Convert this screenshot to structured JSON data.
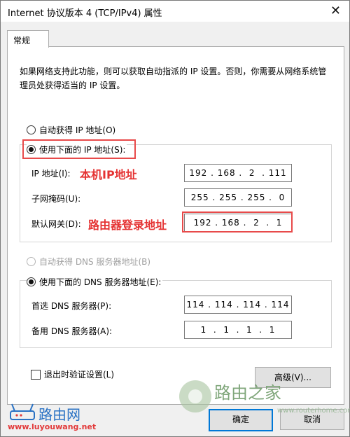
{
  "window": {
    "title": "Internet 协议版本 4 (TCP/IPv4) 属性",
    "close_glyph": "✕"
  },
  "tab": {
    "label": "常规"
  },
  "description": "如果网络支持此功能，则可以获取自动指派的 IP 设置。否则，你需要从网络系统管理员处获得适当的 IP 设置。",
  "ip_section": {
    "auto_label": "自动获得 IP 地址(O)",
    "manual_label": "使用下面的 IP 地址(S):",
    "fields": [
      {
        "label": "IP 地址(I):",
        "value": "192 . 168 .  2  . 111"
      },
      {
        "label": "子网掩码(U):",
        "value": "255 . 255 . 255 .  0"
      },
      {
        "label": "默认网关(D):",
        "value": "192 . 168 .  2  .  1"
      }
    ]
  },
  "dns_section": {
    "auto_label": "自动获得 DNS 服务器地址(B)",
    "manual_label": "使用下面的 DNS 服务器地址(E):",
    "fields": [
      {
        "label": "首选 DNS 服务器(P):",
        "value": "114 . 114 . 114 . 114"
      },
      {
        "label": "备用 DNS 服务器(A):",
        "value": "1  .  1  .  1  .  1"
      }
    ]
  },
  "annotations": {
    "local_ip": "本机IP地址",
    "router_login": "路由器登录地址"
  },
  "validate_label": "退出时验证设置(L)",
  "buttons": {
    "advanced": "高级(V)...",
    "ok": "确定",
    "cancel": "取消"
  },
  "watermarks": {
    "brand1": "路由之家",
    "brand1_url": "www.routerhome.com",
    "brand2": "路由网",
    "brand2_url": "www.luyouwang.net"
  },
  "colors": {
    "annotation": "#e53333",
    "primary_border": "#0078d7"
  }
}
